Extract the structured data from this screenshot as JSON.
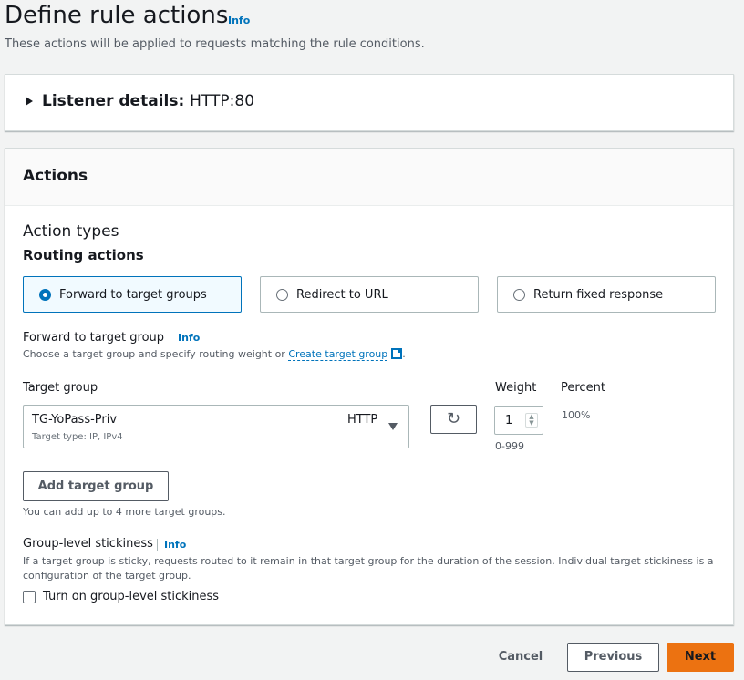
{
  "header": {
    "title": "Define rule actions",
    "info_label": "Info",
    "subtitle": "These actions will be applied to requests matching the rule conditions."
  },
  "listener": {
    "label": "Listener details:",
    "value": "HTTP:80",
    "expand_icon": "caret-right-icon"
  },
  "actions": {
    "title": "Actions",
    "action_types_label": "Action types",
    "routing_actions_label": "Routing actions",
    "options": [
      {
        "label": "Forward to target groups",
        "selected": true
      },
      {
        "label": "Redirect to URL",
        "selected": false
      },
      {
        "label": "Return fixed response",
        "selected": false
      }
    ],
    "forward": {
      "label": "Forward to target group",
      "info_label": "Info",
      "description_prefix": "Choose a target group and specify routing weight or ",
      "create_link": "Create target group",
      "description_suffix": ".",
      "external_icon": "external-link-icon"
    },
    "target_group": {
      "label": "Target group",
      "selected_name": "TG-YoPass-Priv",
      "selected_type": "Target type: IP, IPv4",
      "selected_protocol": "HTTP",
      "refresh_icon": "refresh-icon",
      "weight_label": "Weight",
      "weight_value": "1",
      "weight_range": "0-999",
      "percent_label": "Percent",
      "percent_value": "100%"
    },
    "add_target_group": {
      "button_label": "Add target group",
      "hint": "You can add up to 4 more target groups."
    },
    "stickiness": {
      "label": "Group-level stickiness",
      "info_label": "Info",
      "description": "If a target group is sticky, requests routed to it remain in that target group for the duration of the session. Individual target stickiness is a configuration of the target group.",
      "checkbox_label": "Turn on group-level stickiness",
      "checked": false
    }
  },
  "footer": {
    "cancel_label": "Cancel",
    "previous_label": "Previous",
    "next_label": "Next"
  },
  "colors": {
    "link": "#0073bb",
    "primary_button": "#ec7211",
    "background": "#f2f3f3"
  }
}
